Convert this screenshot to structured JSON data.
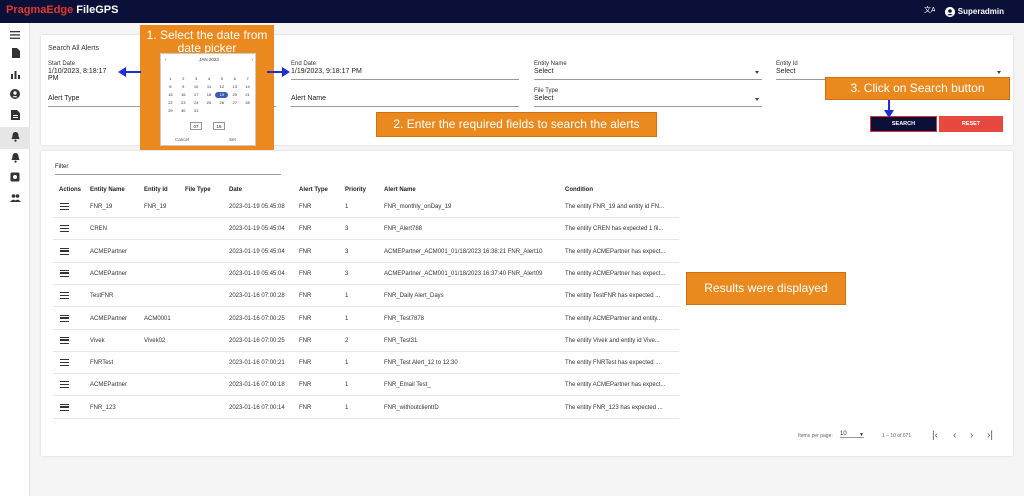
{
  "brand": {
    "part1": "PragmaEdge",
    "part2": "FileGPS"
  },
  "header": {
    "user": "Superadmin",
    "translate_icon": "translate-icon"
  },
  "sidebar": {
    "items": [
      "menu-icon",
      "file-icon",
      "chart-icon",
      "person-icon",
      "document-icon",
      "alert-icon",
      "alert-bell-icon",
      "settings-icon",
      "group-icon"
    ],
    "active": "alert-icon"
  },
  "search": {
    "title": "Search All Alerts",
    "start_date_label": "Start Date",
    "start_date_value": "1/10/2023, 8:18:17 PM",
    "end_date_label": "End Date",
    "end_date_value": "1/19/2023, 9:18:17 PM",
    "entity_name_label": "Entity Name",
    "entity_name_value": "Select",
    "entity_id_label": "Entity Id",
    "entity_id_value": "Select",
    "alert_type_label": "Alert Type",
    "alert_name_label": "Alert Name",
    "file_type_label": "File Type",
    "file_type_value": "Select",
    "search_button": "SEARCH",
    "reset_button": "RESET"
  },
  "datepicker": {
    "month": "JAN 2023",
    "days": [
      "",
      "",
      "",
      "",
      "",
      "",
      "",
      "1",
      "2",
      "3",
      "4",
      "5",
      "6",
      "7",
      "8",
      "9",
      "10",
      "11",
      "12",
      "13",
      "14",
      "15",
      "16",
      "17",
      "18",
      "19",
      "20",
      "21",
      "22",
      "23",
      "24",
      "25",
      "26",
      "27",
      "28",
      "29",
      "30",
      "31",
      "",
      "",
      "",
      ""
    ],
    "selected": "19",
    "hour": "07",
    "minute": "16",
    "cancel": "Cancel",
    "set": "Set"
  },
  "annotations": {
    "step1": "1. Select the date from date picker",
    "step2": "2. Enter the required fields to search the alerts",
    "step3": "3. Click on Search button",
    "results": "Results were displayed",
    "accent": "#ea8a1e"
  },
  "table": {
    "filter_label": "Filter",
    "columns": [
      "Actions",
      "Entity Name",
      "Entity Id",
      "File Type",
      "Date",
      "Alert Type",
      "Priority",
      "Alert Name",
      "Condition"
    ],
    "rows": [
      [
        "FNR_19",
        "FNR_19",
        "",
        "2023-01-19 05:45:08",
        "FNR",
        "1",
        "FNR_monthly_onDay_19",
        "The entity FNR_19 and entity id FN..."
      ],
      [
        "CREN",
        "",
        "",
        "2023-01-19 05:45:04",
        "FNR",
        "3",
        "FNR_Alert788",
        "The entity CREN has expected 1 fil..."
      ],
      [
        "ACMEPartner",
        "",
        "",
        "2023-01-19 05:45:04",
        "FNR",
        "3",
        "ACMEPartner_ACM001_01/18/2023 16:38:21 FNR_Alert10",
        "The entity ACMEPartner has expect..."
      ],
      [
        "ACMEPartner",
        "",
        "",
        "2023-01-19 05:45:04",
        "FNR",
        "3",
        "ACMEPartner_ACM001_01/18/2023 16:37:40 FNR_Alert09",
        "The entity ACMEPartner has expect..."
      ],
      [
        "TestFNR",
        "",
        "",
        "2023-01-16 07:00:28",
        "FNR",
        "1",
        "FNR_Daily Alert_Days",
        "The entity TestFNR has expected ..."
      ],
      [
        "ACMEPartner",
        "ACM0001",
        "",
        "2023-01-16 07:00:25",
        "FNR",
        "1",
        "FNR_Test7878",
        "The entity ACMEPartner and entity..."
      ],
      [
        "Vivek",
        "Vivek02",
        "",
        "2023-01-16 07:00:25",
        "FNR",
        "2",
        "FNR_Test31",
        "The entity Vivek and entity id Vive..."
      ],
      [
        "FNRTest",
        "",
        "",
        "2023-01-16 07:00:21",
        "FNR",
        "1",
        "FNR_Test Alert_12 to 12:30",
        "The entity FNRTest has expected ..."
      ],
      [
        "ACMEPartner",
        "",
        "",
        "2023-01-16 07:00:18",
        "FNR",
        "1",
        "FNR_Email Test_",
        "The entity ACMEPartner has expect..."
      ],
      [
        "FNR_123",
        "",
        "",
        "2023-01-16 07:00:14",
        "FNR",
        "1",
        "FNR_withoutclientID",
        "The entity FNR_123 has expected ..."
      ]
    ]
  },
  "pagination": {
    "items_per_page_label": "Items per page:",
    "items_per_page": "10",
    "range": "1 – 10 of 671"
  }
}
